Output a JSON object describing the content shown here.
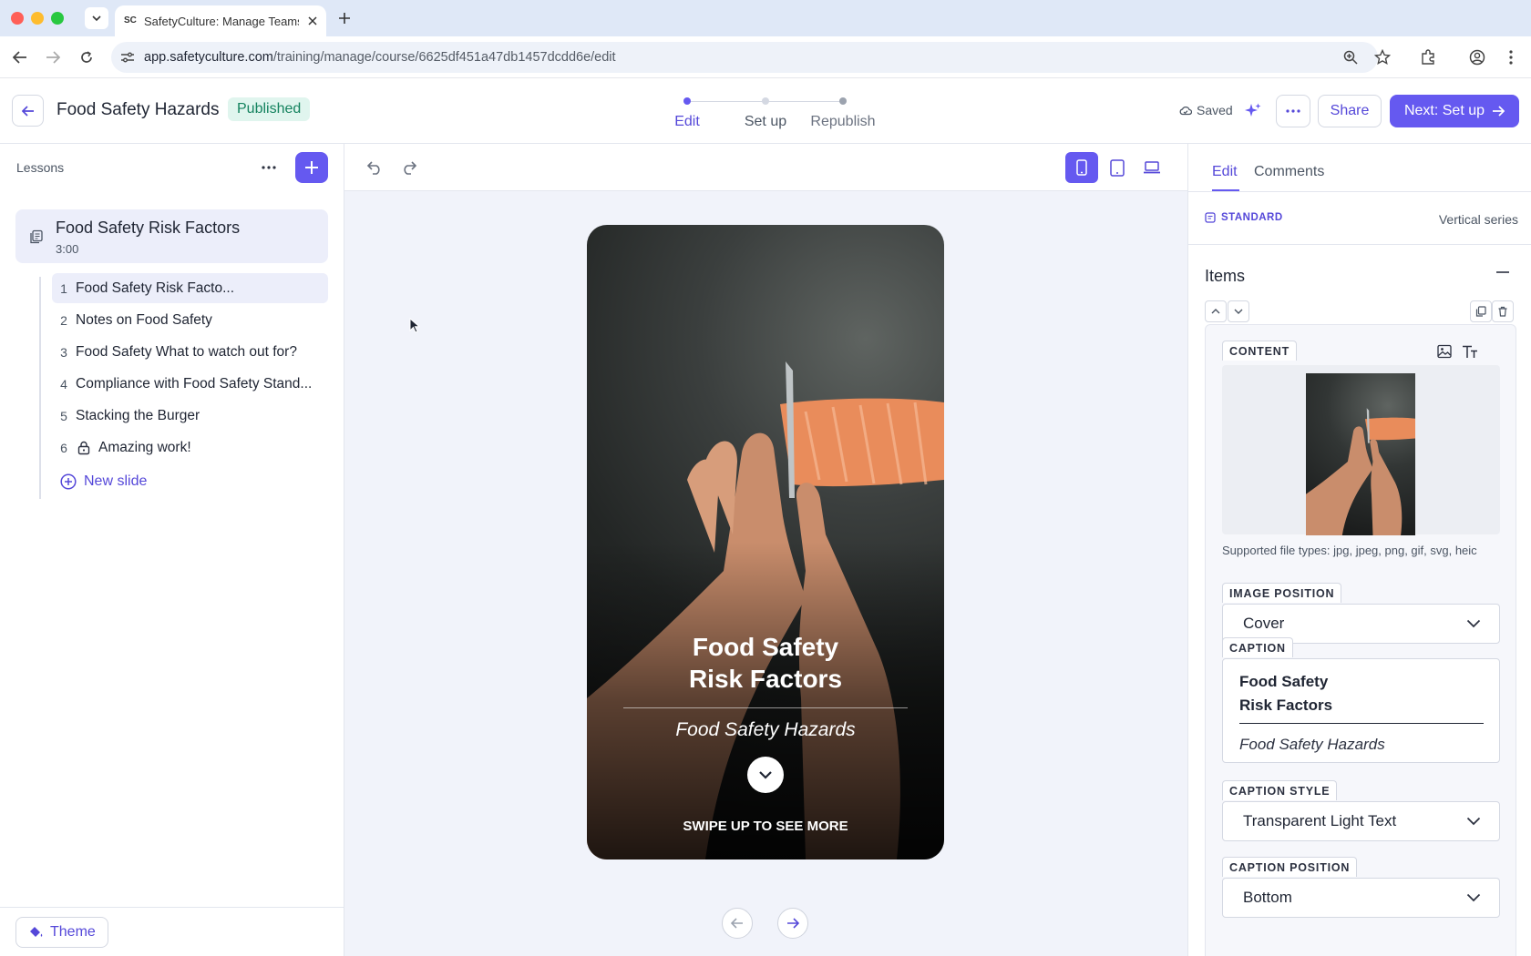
{
  "browser": {
    "tab_title": "SafetyCulture: Manage Teams",
    "url_host": "app.safetyculture.com",
    "url_path": "/training/manage/course/6625df451a47db1457dcdd6e/edit"
  },
  "header": {
    "course_title": "Food Safety Hazards",
    "status": "Published",
    "steps": [
      "Edit",
      "Set up",
      "Republish"
    ],
    "saved_label": "Saved",
    "share_label": "Share",
    "next_label": "Next: Set up"
  },
  "sidebar": {
    "lessons_label": "Lessons",
    "lesson": {
      "title": "Food Safety Risk Factors",
      "duration": "3:00"
    },
    "slides": [
      {
        "num": "1",
        "label": "Food Safety Risk Facto..."
      },
      {
        "num": "2",
        "label": "Notes on Food Safety"
      },
      {
        "num": "3",
        "label": "Food Safety What to watch out for?"
      },
      {
        "num": "4",
        "label": "Compliance with Food Safety Stand..."
      },
      {
        "num": "5",
        "label": "Stacking the Burger"
      },
      {
        "num": "6",
        "label": "Amazing work!"
      }
    ],
    "new_slide_label": "New slide",
    "theme_label": "Theme"
  },
  "preview": {
    "caption_title_line1": "Food Safety",
    "caption_title_line2": "Risk Factors",
    "caption_subtitle": "Food Safety Hazards",
    "swipe_label": "SWIPE UP TO SEE MORE"
  },
  "panel": {
    "tabs": [
      "Edit",
      "Comments"
    ],
    "style_label": "STANDARD",
    "series_label": "Vertical series",
    "items_title": "Items",
    "content_label": "CONTENT",
    "file_types": "Supported file types: jpg, jpeg, png, gif, svg, heic",
    "image_position_label": "IMAGE POSITION",
    "image_position_value": "Cover",
    "caption_label": "CAPTION",
    "caption_title_line1": "Food Safety",
    "caption_title_line2": "Risk Factors",
    "caption_subtitle": "Food Safety Hazards",
    "caption_style_label": "CAPTION STYLE",
    "caption_style_value": "Transparent Light Text",
    "caption_position_label": "CAPTION POSITION",
    "caption_position_value": "Bottom"
  },
  "colors": {
    "accent": "#6559f0",
    "published_bg": "#e0f5ee",
    "published_text": "#15835f"
  }
}
